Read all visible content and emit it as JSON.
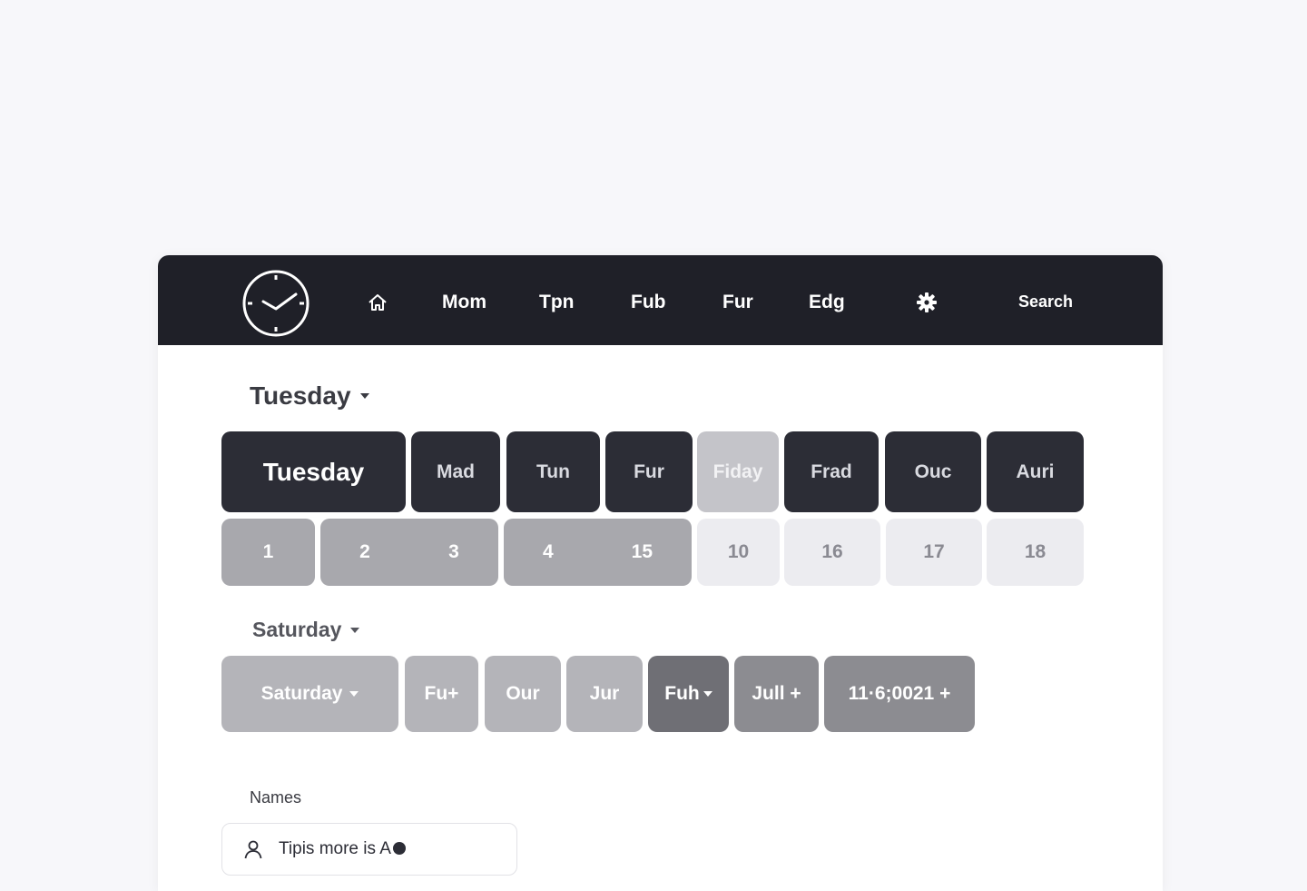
{
  "nav": {
    "links": [
      "Mom",
      "Tpn",
      "Fub",
      "Fur",
      "Edg"
    ],
    "search_label": "Search",
    "icons": {
      "logo": "clock-icon",
      "home": "home-icon",
      "settings": "gear-icon"
    }
  },
  "section1": {
    "label": "Tuesday",
    "days": [
      "Tuesday",
      "Mad",
      "Tun",
      "Fur",
      "Fiday",
      "Frad",
      "Ouc",
      "Auri"
    ],
    "dates": [
      "1",
      "2",
      "3",
      "4",
      "15",
      "10",
      "16",
      "17",
      "18"
    ]
  },
  "section2": {
    "label": "Saturday",
    "chips": [
      "Saturday",
      "Fu+",
      "Our",
      "Jur",
      "Fuh",
      "Jull +",
      "11·6;0021 +"
    ]
  },
  "names": {
    "label": "Names",
    "value": "Tipis more is A"
  },
  "colors": {
    "nav_bg": "#1f2028",
    "dark_tile": "#2c2d36",
    "page_bg": "#f7f7fa"
  }
}
